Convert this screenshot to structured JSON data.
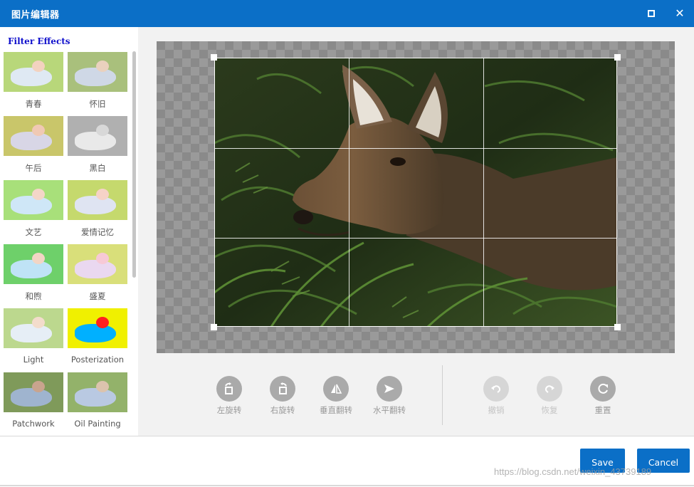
{
  "window": {
    "title": "图片编辑器",
    "maximize_icon": "maximize-icon",
    "close_icon": "close-icon",
    "close_glyph": "✕"
  },
  "sidebar": {
    "heading": "Filter Effects",
    "filters": [
      {
        "label": "青春",
        "bg": "#b8d77a",
        "baby": "#dfe9f3",
        "head": "#f3d2bf"
      },
      {
        "label": "怀旧",
        "bg": "#a9c07c",
        "baby": "#cfd8e6",
        "head": "#ead1be"
      },
      {
        "label": "午后",
        "bg": "#c9c66a",
        "baby": "#d8d6e6",
        "head": "#f0c9b4"
      },
      {
        "label": "黑白",
        "bg": "#b0b0b0",
        "baby": "#e9e9e9",
        "head": "#d8d8d8"
      },
      {
        "label": "文艺",
        "bg": "#a8e07a",
        "baby": "#cfe7f7",
        "head": "#f4d6c8"
      },
      {
        "label": "爱情记忆",
        "bg": "#c5d96d",
        "baby": "#dfe4f2",
        "head": "#f6d2c7"
      },
      {
        "label": "和煦",
        "bg": "#6ed06a",
        "baby": "#bfe3f6",
        "head": "#f2d5c5"
      },
      {
        "label": "盛夏",
        "bg": "#d9df7a",
        "baby": "#ead8f0",
        "head": "#f7c9d6"
      },
      {
        "label": "Light",
        "bg": "#bcd88e",
        "baby": "#e6eef6",
        "head": "#f3dccc"
      },
      {
        "label": "Posterization",
        "bg": "#f0f000",
        "baby": "#00b0ff",
        "head": "#ff2020"
      },
      {
        "label": "Patchwork",
        "bg": "#7f9a5a",
        "baby": "#9fb4cf",
        "head": "#c9a48e"
      },
      {
        "label": "Oil Painting",
        "bg": "#93b26a",
        "baby": "#b9c9e2",
        "head": "#dcc3ad"
      }
    ]
  },
  "tools": {
    "left": [
      {
        "label": "左旋转",
        "icon": "rotate-left-icon",
        "enabled": true
      },
      {
        "label": "右旋转",
        "icon": "rotate-right-icon",
        "enabled": true
      },
      {
        "label": "垂直翻转",
        "icon": "flip-vertical-icon",
        "enabled": true
      },
      {
        "label": "水平翻转",
        "icon": "flip-horizontal-icon",
        "enabled": true
      }
    ],
    "right": [
      {
        "label": "撤销",
        "icon": "undo-icon",
        "enabled": false
      },
      {
        "label": "恢复",
        "icon": "redo-icon",
        "enabled": false
      },
      {
        "label": "重置",
        "icon": "reset-icon",
        "enabled": true
      }
    ]
  },
  "footer": {
    "save_label": "Save",
    "cancel_label": "Cancel",
    "watermark": "https://blog.csdn.net/weixin_43739189"
  },
  "colors": {
    "accent": "#0b6fc7",
    "tool_icon": "#aaaaaa",
    "tool_icon_disabled": "#d6d6d6"
  }
}
